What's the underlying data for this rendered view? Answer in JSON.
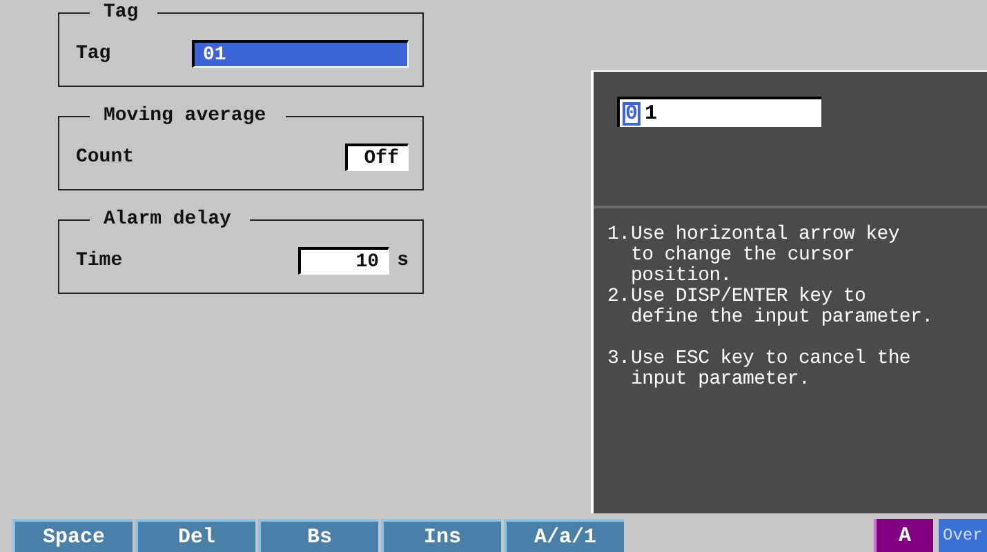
{
  "settings_groups": [
    {
      "title": "Tag",
      "fields": [
        {
          "label": "Tag",
          "value": "01",
          "selected": true,
          "kind": "text"
        }
      ]
    },
    {
      "title": "Moving average",
      "fields": [
        {
          "label": "Count",
          "value": "Off",
          "selected": false,
          "kind": "choice"
        }
      ]
    },
    {
      "title": "Alarm delay",
      "fields": [
        {
          "label": "Time",
          "value": "10",
          "unit": "s",
          "selected": false,
          "kind": "number"
        }
      ]
    }
  ],
  "input_dialog": {
    "entry": [
      {
        "char": "0",
        "selected": true
      },
      {
        "char": "1",
        "selected": false
      }
    ],
    "help": [
      [
        {
          "number": "1.",
          "lines": [
            "Use horizontal arrow key",
            "to change the cursor",
            "position."
          ]
        },
        {
          "number": "2.",
          "lines": [
            "Use DISP/ENTER key to",
            "define the input parameter."
          ]
        }
      ],
      [
        {
          "number": "3.",
          "lines": [
            "Use ESC key to cancel the",
            "input parameter."
          ]
        }
      ]
    ]
  },
  "soft_keys": [
    "Space",
    "Del",
    "Bs",
    "Ins",
    "A/a/1"
  ],
  "indicators": [
    {
      "label": "A",
      "color": "#800080"
    },
    {
      "label": "Over",
      "color": "#3a6fd8"
    }
  ]
}
